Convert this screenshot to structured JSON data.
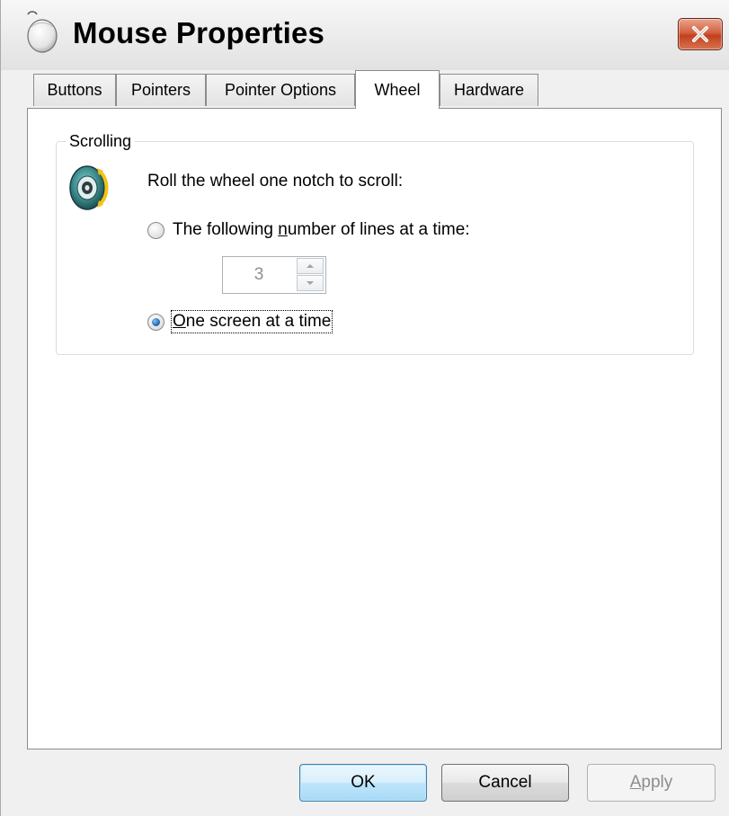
{
  "window": {
    "title": "Mouse Properties",
    "icon": "mouse-icon",
    "close_icon": "close-icon"
  },
  "tabs": [
    {
      "label": "Buttons",
      "active": false
    },
    {
      "label": "Pointers",
      "active": false
    },
    {
      "label": "Pointer Options",
      "active": false
    },
    {
      "label": "Wheel",
      "active": true
    },
    {
      "label": "Hardware",
      "active": false
    }
  ],
  "scrolling": {
    "group_label": "Scrolling",
    "icon": "mouse-wheel-icon",
    "prompt": "Roll the wheel one notch to scroll:",
    "option_lines": {
      "label_before": "The following ",
      "label_access": "n",
      "label_after": "umber of lines at a time:",
      "checked": false
    },
    "lines_value": "3",
    "option_screen": {
      "label_access": "O",
      "label_after": "ne screen at a time",
      "checked": true
    }
  },
  "buttons": {
    "ok": "OK",
    "cancel": "Cancel",
    "apply_access": "A",
    "apply_after": "pply"
  },
  "colors": {
    "close_button": "#c2401d",
    "ok_button_border": "#3c7fb1",
    "radio_dot": "#1b5fa8",
    "disabled_text": "#8d8d8d"
  }
}
